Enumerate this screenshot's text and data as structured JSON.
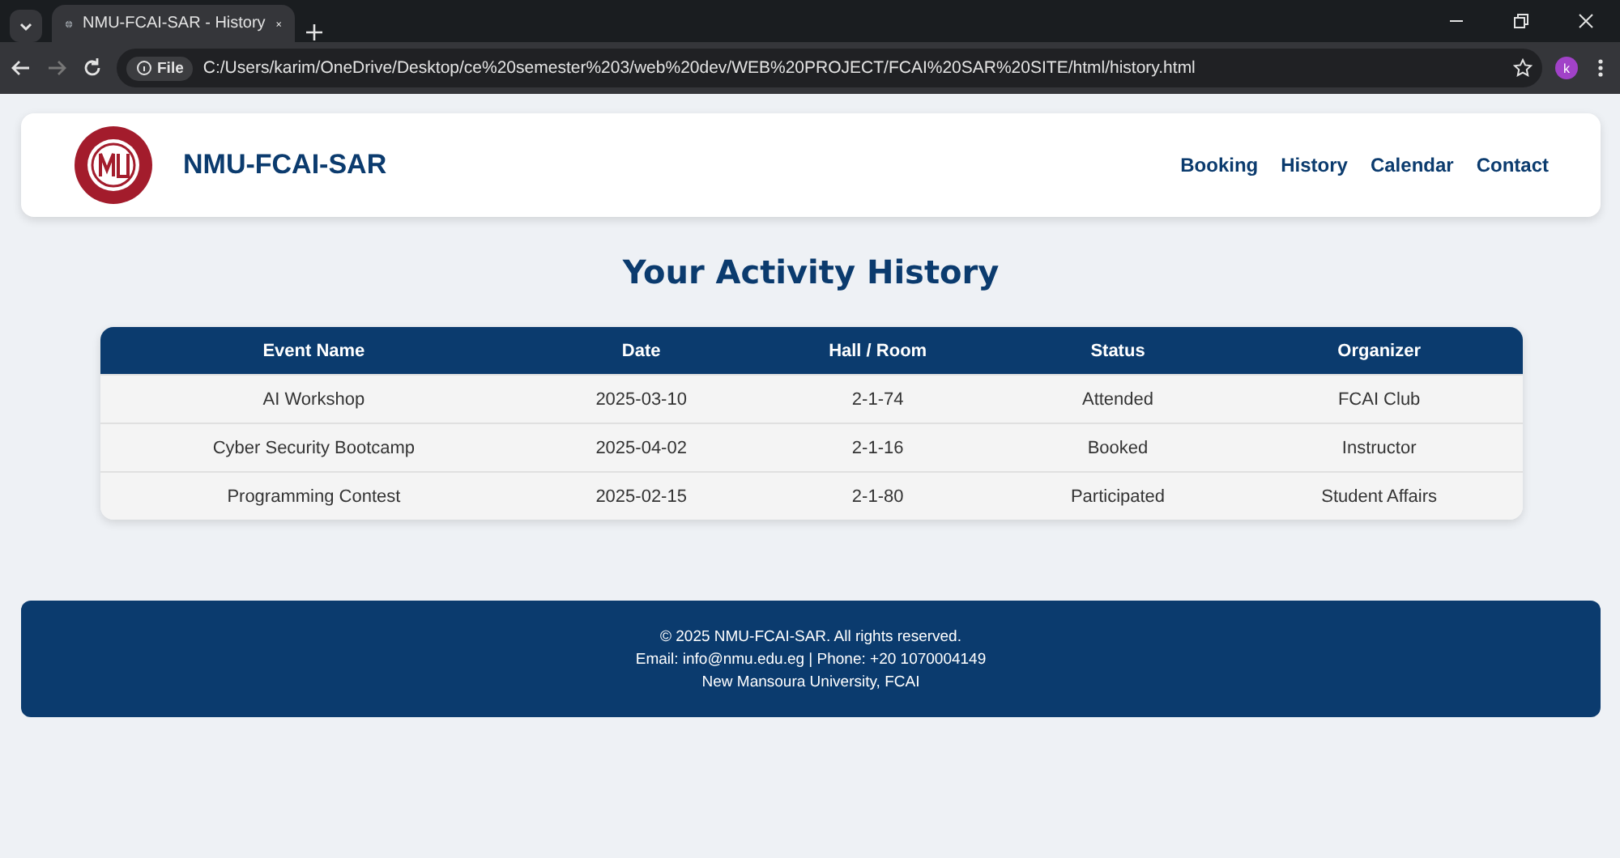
{
  "browser": {
    "tab_title": "NMU-FCAI-SAR - History",
    "file_badge": "File",
    "url": "C:/Users/karim/OneDrive/Desktop/ce%20semester%203/web%20dev/WEB%20PROJECT/FCAI%20SAR%20SITE/html/history.html",
    "profile_initial": "k"
  },
  "header": {
    "site_name": "NMU-FCAI-SAR",
    "nav": [
      {
        "label": "Booking"
      },
      {
        "label": "History"
      },
      {
        "label": "Calendar"
      },
      {
        "label": "Contact"
      }
    ]
  },
  "page_title": "Your Activity History",
  "table": {
    "columns": [
      "Event Name",
      "Date",
      "Hall / Room",
      "Status",
      "Organizer"
    ],
    "rows": [
      [
        "AI Workshop",
        "2025-03-10",
        "2-1-74",
        "Attended",
        "FCAI Club"
      ],
      [
        "Cyber Security Bootcamp",
        "2025-04-02",
        "2-1-16",
        "Booked",
        "Instructor"
      ],
      [
        "Programming Contest",
        "2025-02-15",
        "2-1-80",
        "Participated",
        "Student Affairs"
      ]
    ]
  },
  "footer": {
    "lines": [
      "© 2025 NMU-FCAI-SAR. All rights reserved.",
      "Email: info@nmu.edu.eg | Phone: +20 1070004149",
      "New Mansoura University, FCAI"
    ]
  }
}
